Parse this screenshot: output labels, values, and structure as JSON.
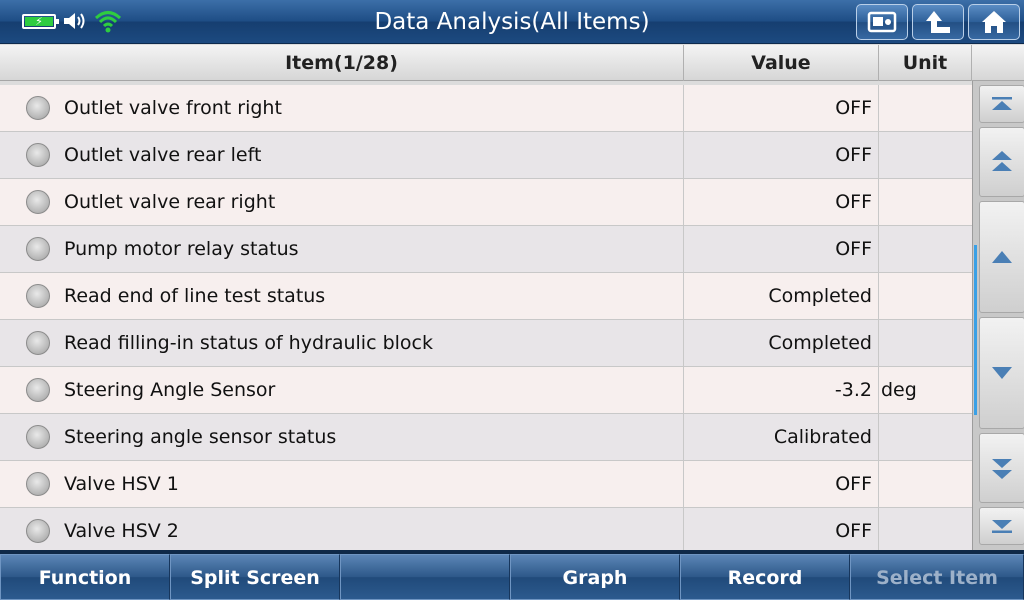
{
  "title": "Data Analysis(All Items)",
  "header": {
    "item_col": "Item(1/28)",
    "value_col": "Value",
    "unit_col": "Unit"
  },
  "rows": [
    {
      "item": "Outlet valve front right",
      "value": "OFF",
      "unit": ""
    },
    {
      "item": "Outlet valve rear left",
      "value": "OFF",
      "unit": ""
    },
    {
      "item": "Outlet valve rear right",
      "value": "OFF",
      "unit": ""
    },
    {
      "item": "Pump motor relay status",
      "value": "OFF",
      "unit": ""
    },
    {
      "item": "Read end of line test status",
      "value": "Completed",
      "unit": ""
    },
    {
      "item": "Read filling-in status of hydraulic block",
      "value": "Completed",
      "unit": ""
    },
    {
      "item": "Steering Angle Sensor",
      "value": "-3.2",
      "unit": "deg"
    },
    {
      "item": "Steering angle sensor status",
      "value": "Calibrated",
      "unit": ""
    },
    {
      "item": "Valve HSV 1",
      "value": "OFF",
      "unit": ""
    },
    {
      "item": "Valve HSV 2",
      "value": "OFF",
      "unit": ""
    }
  ],
  "toolbar": {
    "function": "Function",
    "split_screen": "Split Screen",
    "empty": "",
    "graph": "Graph",
    "record": "Record",
    "select_item": "Select Item"
  },
  "icons": {
    "battery": "battery-charging-icon",
    "volume": "volume-icon",
    "wifi": "wifi-icon",
    "screenshot": "screenshot-icon",
    "back": "back-arrow-icon",
    "home": "home-icon"
  },
  "colors": {
    "accent": "#2d5f98",
    "battery_fill": "#2ecc40",
    "wifi": "#2ecc40",
    "scroll_thumb": "#3aa0e6"
  }
}
